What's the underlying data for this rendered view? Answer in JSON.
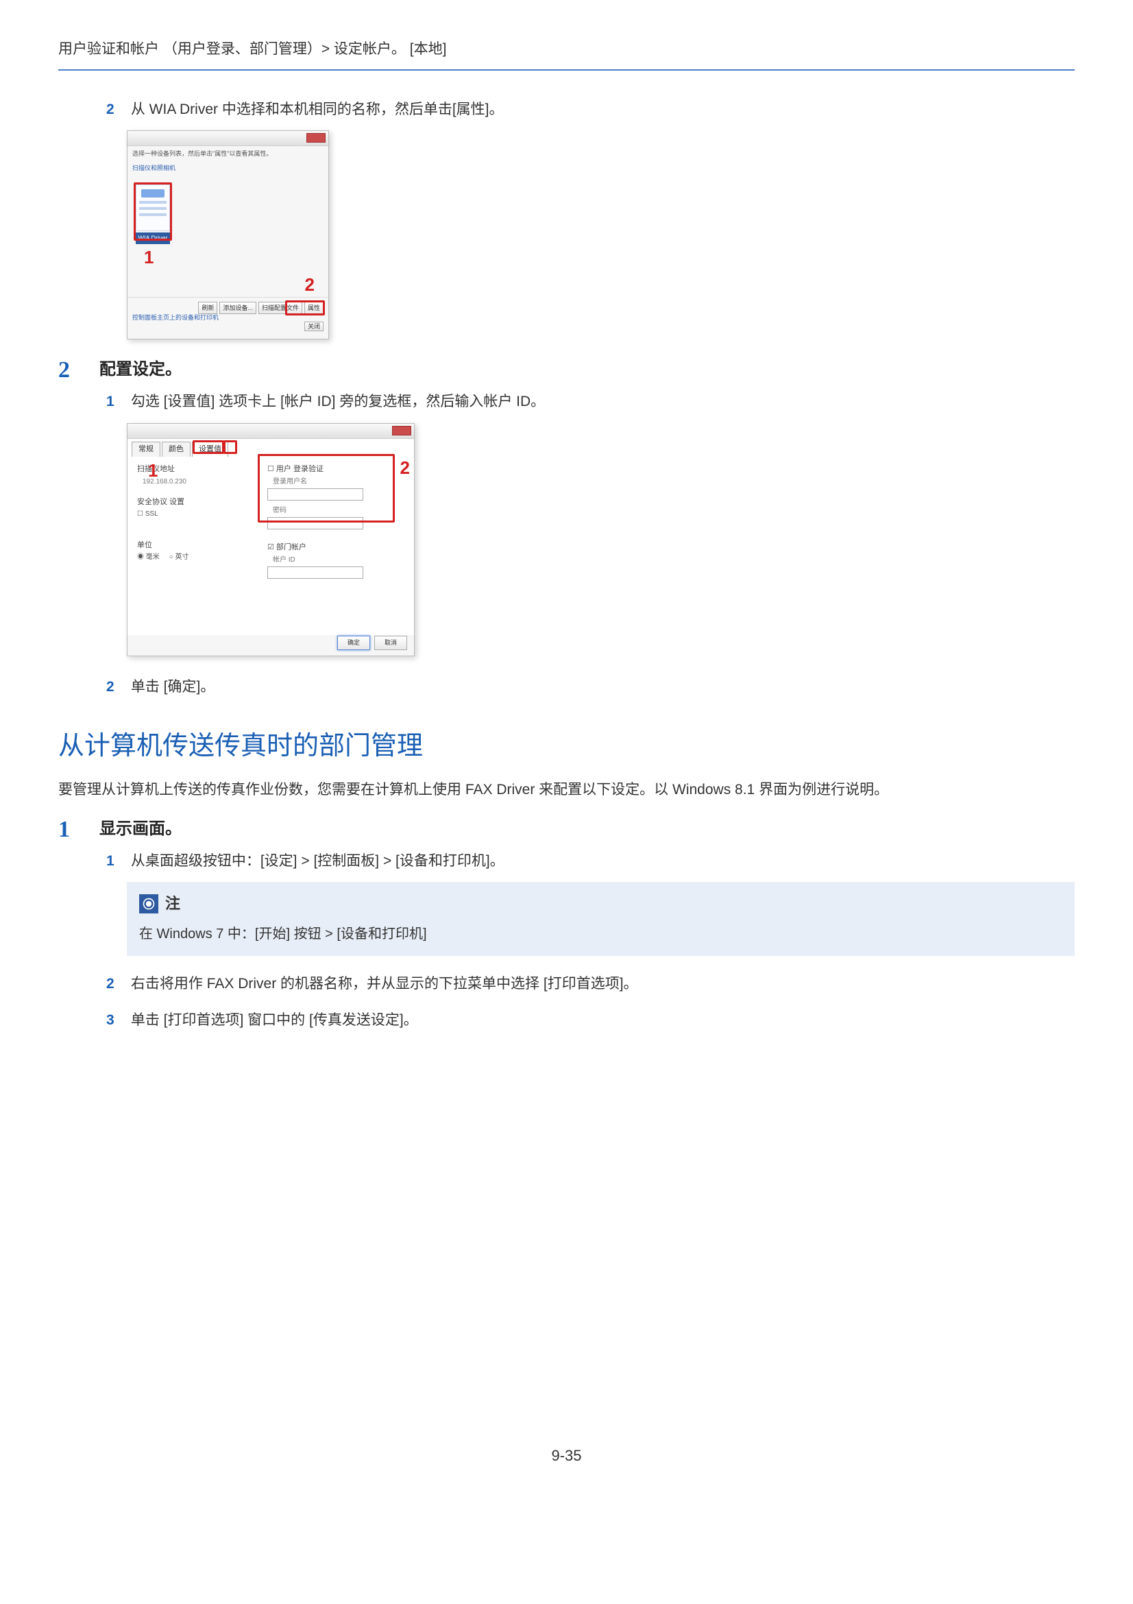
{
  "breadcrumb": "用户验证和帐户 （用户登录、部门管理）> 设定帐户。 [本地]",
  "s1": {
    "n": "2",
    "t": "从 WIA Driver 中选择和本机相同的名称，然后单击[属性]。"
  },
  "fig1": {
    "desc": "选择一种设备列表，然后单击\"属性\"以查看其属性。",
    "link": "扫描仪和照相机",
    "label": "WIA Driver",
    "btns": [
      "刷新",
      "添加设备...",
      "扫描配置文件",
      "属性"
    ],
    "footer_link": "控制面板主页上的设备和打印机",
    "close_btn": "关闭",
    "r1": "1",
    "r2": "2"
  },
  "bigstep2": {
    "n": "2",
    "t": "配置设定。"
  },
  "s2": {
    "n": "1",
    "t": "勾选 [设置值] 选项卡上 [帐户 ID] 旁的复选框，然后输入帐户 ID。"
  },
  "fig2": {
    "tabs": [
      "常规",
      "颜色",
      "设置值"
    ],
    "f1": "扫描仪地址",
    "v1": "192.168.0.230",
    "f2": "安全协议 设置",
    "cb": "SSL",
    "f3": "单位",
    "r_mm": "毫米",
    "r_in": "英寸",
    "g1": "用户 登录验证",
    "g1f1": "登录用户名",
    "g1f2": "密码",
    "g2": "部门帐户",
    "g2f": "帐户 ID",
    "ok": "确定",
    "cancel": "取消",
    "r1": "1",
    "r2": "2"
  },
  "s3": {
    "n": "2",
    "t": "单击 [确定]。"
  },
  "section2": "从计算机传送传真时的部门管理",
  "para2": "要管理从计算机上传送的传真作业份数，您需要在计算机上使用 FAX Driver 来配置以下设定。以 Windows 8.1 界面为例进行说明。",
  "bigstep1b": {
    "n": "1",
    "t": "显示画面。"
  },
  "s4": {
    "n": "1",
    "t": "从桌面超级按钮中：[设定] > [控制面板] > [设备和打印机]。"
  },
  "note": {
    "label": "注",
    "text": "在 Windows 7 中：[开始] 按钮 > [设备和打印机]"
  },
  "s5": {
    "n": "2",
    "t": "右击将用作 FAX Driver 的机器名称，并从显示的下拉菜单中选择 [打印首选项]。"
  },
  "s6": {
    "n": "3",
    "t": "单击 [打印首选项] 窗口中的 [传真发送设定]。"
  },
  "pg": "9-35"
}
